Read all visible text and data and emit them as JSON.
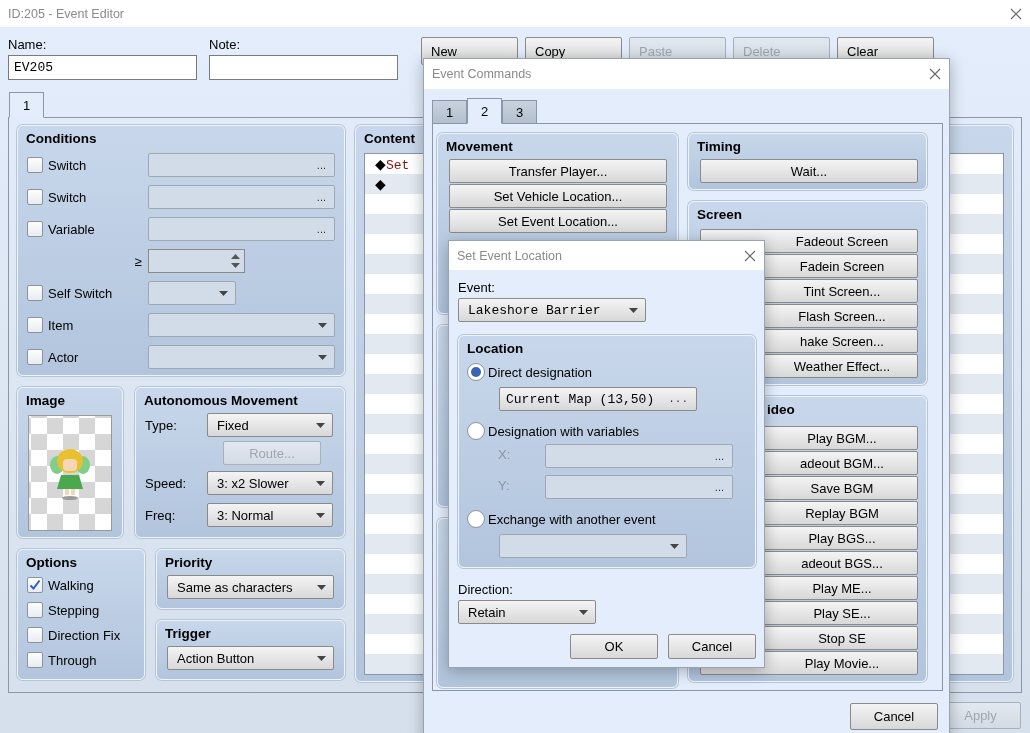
{
  "window": {
    "title": "ID:205 - Event Editor"
  },
  "name": {
    "label": "Name:",
    "value": "EV205"
  },
  "note": {
    "label": "Note:"
  },
  "page_buttons": [
    {
      "label": "New",
      "disabled": false
    },
    {
      "label": "Copy",
      "disabled": false
    },
    {
      "label": "Paste",
      "disabled": true
    },
    {
      "label": "Delete",
      "disabled": true
    },
    {
      "label": "Clear",
      "disabled": false
    }
  ],
  "page_tabs": [
    {
      "label": "1",
      "selected": true
    }
  ],
  "conditions": {
    "title": "Conditions",
    "rows": [
      {
        "kind": "picker",
        "label": "Switch",
        "checked": false,
        "button": "..."
      },
      {
        "kind": "picker",
        "label": "Switch",
        "checked": false,
        "button": "..."
      },
      {
        "kind": "picker",
        "label": "Variable",
        "checked": false,
        "button": "..."
      },
      {
        "kind": "compare",
        "label": "≥"
      },
      {
        "kind": "short_dropdown",
        "label": "Self Switch",
        "checked": false
      },
      {
        "kind": "dropdown",
        "label": "Item",
        "checked": false
      },
      {
        "kind": "dropdown",
        "label": "Actor",
        "checked": false
      }
    ]
  },
  "image": {
    "title": "Image"
  },
  "autonomous_movement": {
    "title": "Autonomous Movement",
    "type": {
      "label": "Type:",
      "value": "Fixed"
    },
    "route": {
      "label": "Route...",
      "disabled": true
    },
    "speed": {
      "label": "Speed:",
      "value": "3: x2 Slower"
    },
    "freq": {
      "label": "Freq:",
      "value": "3: Normal"
    }
  },
  "options": {
    "title": "Options",
    "items": [
      {
        "label": "Walking",
        "checked": true
      },
      {
        "label": "Stepping",
        "checked": false
      },
      {
        "label": "Direction Fix",
        "checked": false
      },
      {
        "label": "Through",
        "checked": false
      }
    ]
  },
  "priority": {
    "title": "Priority",
    "value": "Same as characters"
  },
  "trigger": {
    "title": "Trigger",
    "value": "Action Button"
  },
  "contents": {
    "title": "Content",
    "items": [
      {
        "marker": "◆",
        "text": "Set"
      },
      {
        "marker": "◆"
      }
    ]
  },
  "footer_buttons": [
    {
      "label": "Apply",
      "disabled": true
    }
  ],
  "event_commands": {
    "title": "Event Commands",
    "tabs": [
      {
        "label": "1",
        "selected": false
      },
      {
        "label": "2",
        "selected": true
      },
      {
        "label": "3",
        "selected": false
      }
    ],
    "left_groups": [
      {
        "title": "Movement",
        "buttons": [
          "Transfer Player...",
          "Set Vehicle Location...",
          "Set Event Location..."
        ]
      }
    ],
    "right_groups": [
      {
        "title": "Timing",
        "buttons": [
          "Wait..."
        ]
      },
      {
        "title": "Screen",
        "buttons": [
          "Fadeout Screen",
          "Fadein Screen",
          "Tint Screen...",
          "Flash Screen...",
          "hake Screen...",
          "Weather Effect..."
        ]
      },
      {
        "title": "ideo",
        "buttons": [
          "Play BGM...",
          "adeout BGM...",
          "Save BGM",
          "Replay BGM",
          "Play BGS...",
          "adeout BGS...",
          "Play ME...",
          "Play SE...",
          "Stop SE",
          "Play Movie..."
        ]
      }
    ],
    "cancel": "Cancel"
  },
  "set_event_location": {
    "title": "Set Event Location",
    "event": {
      "label": "Event:",
      "value": "Lakeshore Barrier"
    },
    "location": {
      "title": "Location",
      "options": [
        {
          "kind": "picker",
          "label": "Direct designation",
          "selected": true,
          "value": "Current Map (13,50)",
          "button": "..."
        },
        {
          "kind": "variables",
          "label": "Designation with variables",
          "selected": false,
          "fields": [
            {
              "label": "X:",
              "button": "...",
              "disabled": true
            },
            {
              "label": "Y:",
              "button": "...",
              "disabled": true
            }
          ]
        },
        {
          "kind": "dropdown",
          "label": "Exchange with another event",
          "selected": false
        }
      ]
    },
    "direction": {
      "label": "Direction:",
      "value": "Retain"
    },
    "buttons": [
      "OK",
      "Cancel"
    ]
  }
}
